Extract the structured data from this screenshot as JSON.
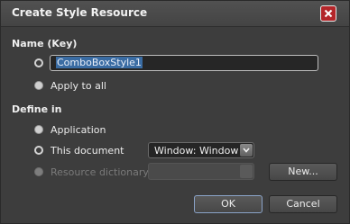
{
  "dialog": {
    "title": "Create Style Resource",
    "close_icon": "close-icon",
    "accent_color": "#b3262a"
  },
  "name_section": {
    "label": "Name (Key)",
    "key_input_value": "ComboBoxStyle1",
    "key_option_selected": true,
    "apply_to_all_label": "Apply to all",
    "apply_to_all_selected": false
  },
  "define_section": {
    "label": "Define in",
    "application_label": "Application",
    "application_selected": false,
    "this_document_label": "This document",
    "this_document_selected": true,
    "document_combo_value": "Window: Window",
    "resource_dictionary_label": "Resource dictionary",
    "resource_dictionary_enabled": false,
    "resource_dictionary_combo_value": "",
    "new_button_label": "New..."
  },
  "footer": {
    "ok_label": "OK",
    "cancel_label": "Cancel"
  }
}
